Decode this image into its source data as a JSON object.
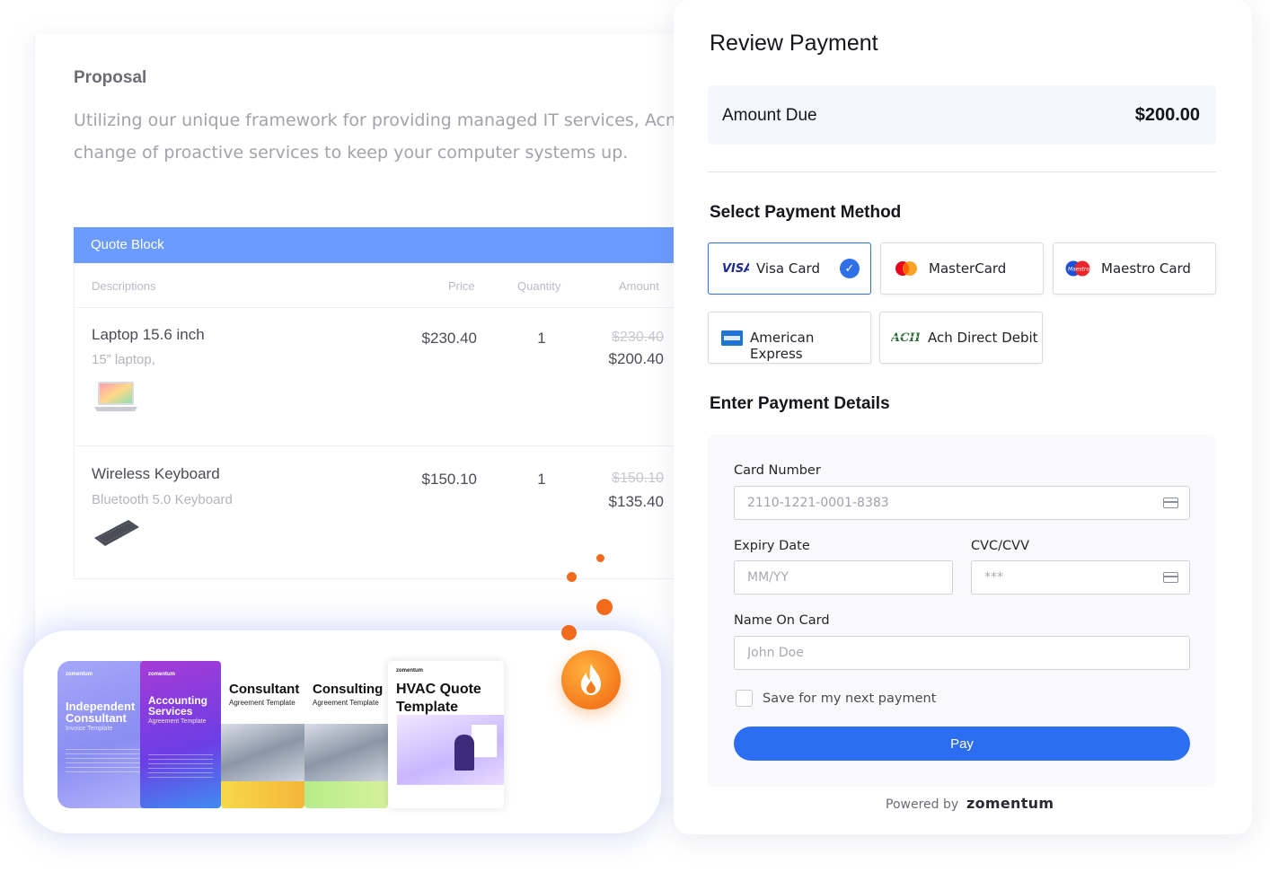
{
  "proposal": {
    "title": "Proposal",
    "body_lines": [
      "Utilizing our unique framework for providing managed IT services, Acme  prov",
      "change of proactive services to keep your computer systems up."
    ],
    "quote_block": {
      "title": "Quote Block",
      "headers": [
        "Descriptions",
        "Price",
        "Quantity",
        "Amount"
      ],
      "rows": [
        {
          "name": "Laptop 15.6 inch",
          "desc": "15” laptop,",
          "price": "$230.40",
          "qty": "1",
          "old_amount": "$230.40",
          "amount": "$200.40",
          "image": "laptop-image"
        },
        {
          "name": "Wireless Keyboard",
          "desc": "Bluetooth 5.0 Keyboard",
          "price": "$150.10",
          "qty": "1",
          "old_amount": "$150.10",
          "amount": "$135.40",
          "image": "keyboard-image"
        }
      ]
    }
  },
  "templates": [
    {
      "logo": "zomentum",
      "title_lines": [
        "Independent",
        "Consultant"
      ],
      "subtitle": "Invoice Template"
    },
    {
      "logo": "zomentum",
      "title_lines": [
        "Accounting",
        "Services"
      ],
      "subtitle": "Agreement Template"
    },
    {
      "logo": "",
      "title_lines": [
        "Consultant"
      ],
      "subtitle": "Agreement Template"
    },
    {
      "logo": "",
      "title_lines": [
        "Consulting"
      ],
      "subtitle": "Agreement Template"
    },
    {
      "logo": "zomentum",
      "title_lines": [
        "HVAC Quote",
        "Template"
      ],
      "subtitle": ""
    }
  ],
  "payment": {
    "title": "Review Payment",
    "amount_due_label": "Amount Due",
    "amount_due_value": "$200.00",
    "method_heading": "Select Payment Method",
    "methods": [
      {
        "label": "Visa Card",
        "icon": "visa-icon",
        "selected": true
      },
      {
        "label": "MasterCard",
        "icon": "mastercard-icon",
        "selected": false
      },
      {
        "label": "Maestro Card",
        "icon": "maestro-icon",
        "selected": false
      },
      {
        "label": "American Express",
        "icon": "amex-icon",
        "selected": false
      },
      {
        "label": "Ach Direct Debit",
        "icon": "ach-icon",
        "selected": false
      }
    ],
    "details_heading": "Enter Payment Details",
    "card_number": {
      "label": "Card Number",
      "value": "2110-1221-0001-8383"
    },
    "expiry": {
      "label": "Expiry Date",
      "placeholder": "MM/YY"
    },
    "cvc": {
      "label": "CVC/CVV",
      "placeholder": "***"
    },
    "name": {
      "label": "Name On Card",
      "placeholder": "John Doe"
    },
    "save_label": "Save for my next payment",
    "save_checked": false,
    "pay_label": "Pay",
    "powered_by": "Powered by",
    "brand": "zomentum"
  },
  "colors": {
    "accent": "#2c6ef2",
    "quote_bar": "#6b9bff",
    "flame": "#f57a1d"
  }
}
